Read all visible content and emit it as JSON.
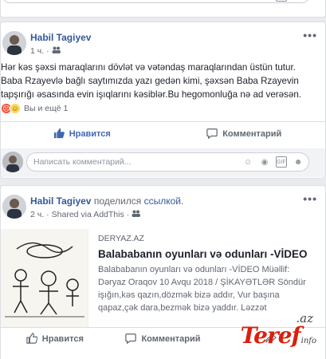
{
  "top_toolbar": {
    "icons": [
      "emoji-icon",
      "camera-icon",
      "gif-icon",
      "sticker-icon"
    ]
  },
  "post1": {
    "author": "Habil Tagiyev",
    "time": "1 ч.",
    "privacy_icon": "friends-icon",
    "more": "•••",
    "text": "Hər kəs şəxsi maraqlarını dövlət və vətəndaş maraqlarından üstün tutur. Baba Rzayevlə bağlı saytımızda yazı gedən kimi, şəxsən Baba Rzayevin tapşırığı əsasında evin işıqlarını kəsiblər.Bu hegomonluğa nə ad verəsən.",
    "reactions_text": "Вы и ещё 1",
    "actions": {
      "like": "Нравится",
      "comment": "Комментарий"
    },
    "comment_placeholder": "Написать комментарий..."
  },
  "post2": {
    "author": "Habil Tagiyev",
    "shared_verb": "поделился",
    "shared_object": "ссылкой.",
    "time": "2 ч.",
    "via": "Shared via AddThis",
    "more": "•••",
    "link": {
      "domain": "DERYAZ.AZ",
      "title": "Balababanın oyunları və odunları -VİDEO",
      "description": "Balababanın oyunları və odunları -VİDEO Müəllif: Dəryaz Oraqov 10 Avqu 2018 / ŞİKAYƏTLƏR Söndür işığın,kəs qazın,dözmək bizə addır, Vur başına qapaz,çək dara,bezmək bizə yaddır. Ləzzət"
    },
    "actions": {
      "like": "Нравится",
      "comment": "Комментарий"
    }
  },
  "watermark": {
    "main": "Teref",
    "az": ".az",
    "sub": "info"
  },
  "colors": {
    "link": "#365899",
    "like_active": "#4267b2",
    "muted": "#606770",
    "watermark": "#d9200f"
  }
}
